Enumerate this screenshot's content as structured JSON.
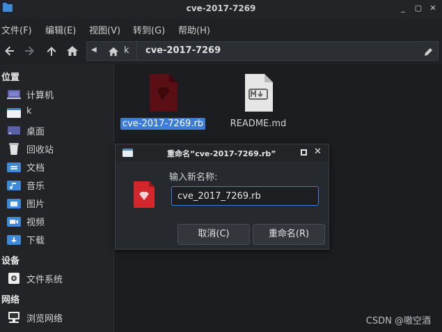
{
  "window": {
    "title": "cve-2017-7269",
    "controls": [
      "_",
      "▢",
      "✕"
    ]
  },
  "menu": [
    "文件(F)",
    "编辑(E)",
    "视图(V)",
    "转到(G)",
    "帮助(H)"
  ],
  "pathbar": {
    "home_segment": "k",
    "current": "cve-2017-7269"
  },
  "sidebar": {
    "sections": [
      {
        "heading": "位置",
        "items": [
          {
            "label": "计算机",
            "icon": "computer-icon"
          },
          {
            "label": "k",
            "icon": "home-folder-icon"
          },
          {
            "label": "桌面",
            "icon": "desktop-icon"
          },
          {
            "label": "回收站",
            "icon": "trash-icon"
          },
          {
            "label": "文档",
            "icon": "documents-icon"
          },
          {
            "label": "音乐",
            "icon": "music-icon"
          },
          {
            "label": "图片",
            "icon": "pictures-icon"
          },
          {
            "label": "视频",
            "icon": "videos-icon"
          },
          {
            "label": "下载",
            "icon": "downloads-icon"
          }
        ]
      },
      {
        "heading": "设备",
        "items": [
          {
            "label": "文件系统",
            "icon": "drive-icon"
          }
        ]
      },
      {
        "heading": "网络",
        "items": [
          {
            "label": "浏览网络",
            "icon": "network-icon"
          }
        ]
      }
    ]
  },
  "files": [
    {
      "name": "cve-2017-7269.rb",
      "icon": "ruby-file-icon",
      "selected": true
    },
    {
      "name": "README.md",
      "icon": "markdown-file-icon",
      "selected": false
    }
  ],
  "dialog": {
    "title": "重命名“cve-2017-7269.rb”",
    "label": "输入新名称:",
    "value": "cve_2017_7269.rb",
    "cancel": "取消(C)",
    "rename": "重命名(R)"
  },
  "watermark": "CSDN @嗷空酒",
  "colors": {
    "accent": "#3b7dd8",
    "ruby_red": "#d3262c",
    "background": "#1f2124"
  }
}
